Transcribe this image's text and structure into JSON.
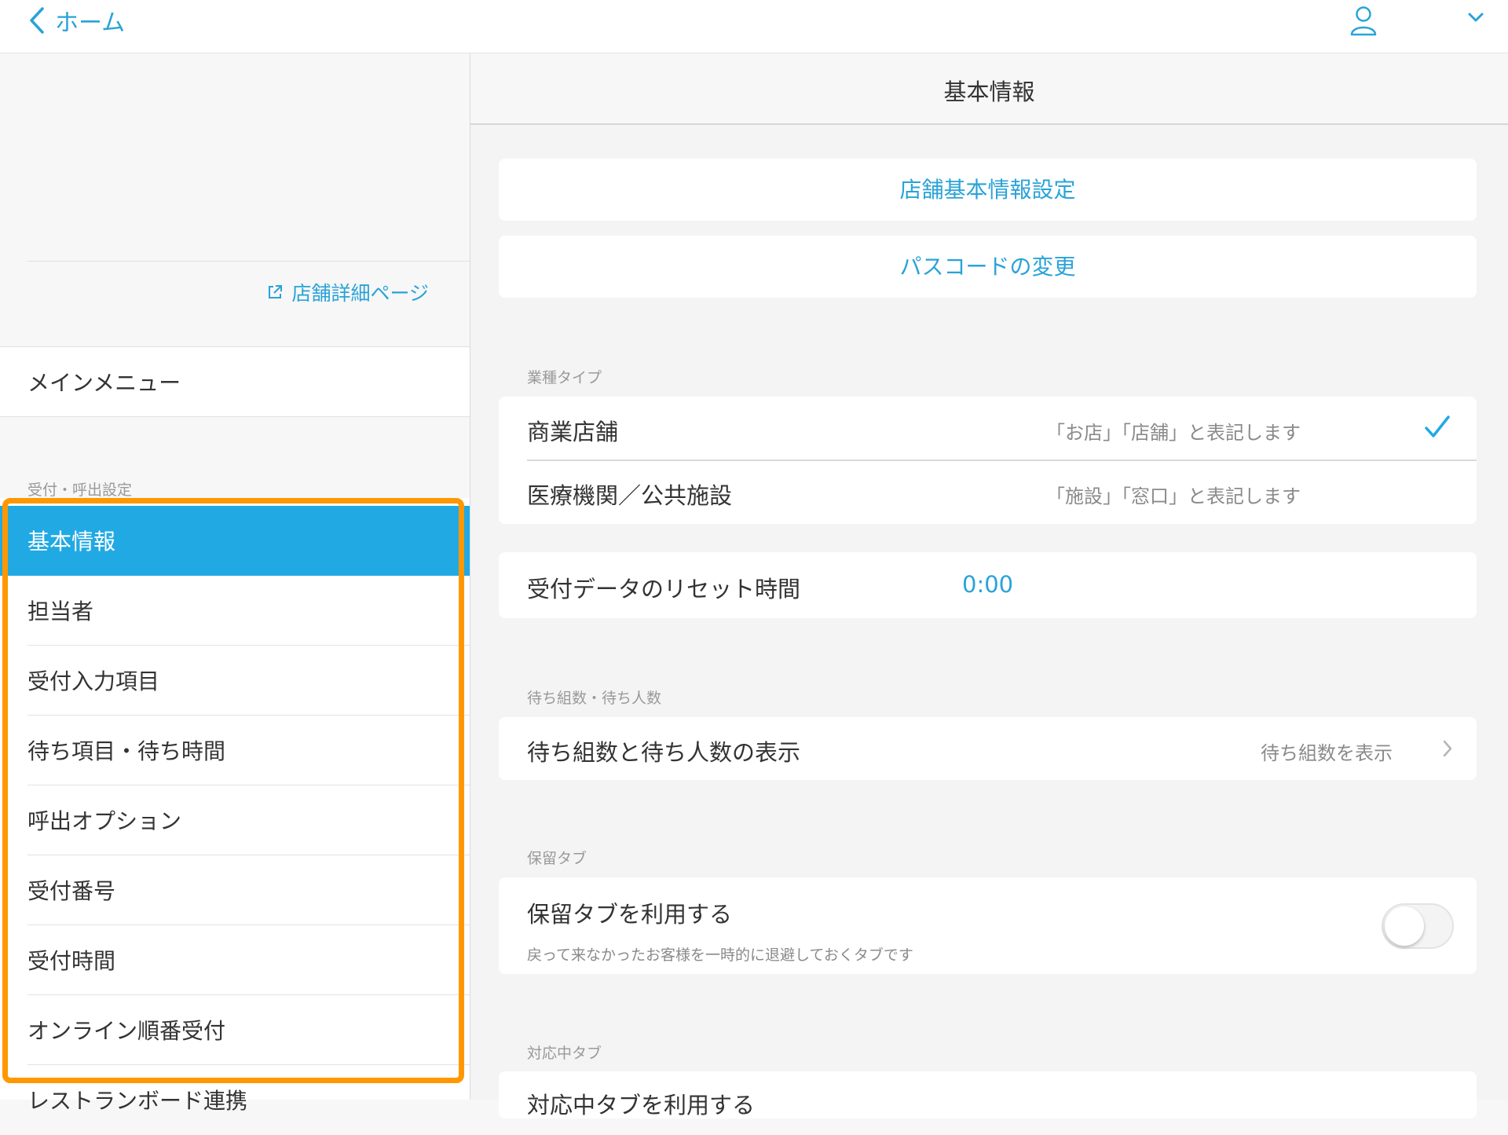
{
  "topbar": {
    "back_label": "ホーム"
  },
  "sidebar": {
    "store_link": "店舗詳細ページ",
    "main_menu": "メインメニュー",
    "section_caption": "受付・呼出設定",
    "items": [
      {
        "label": "基本情報",
        "active": true
      },
      {
        "label": "担当者"
      },
      {
        "label": "受付入力項目"
      },
      {
        "label": "待ち項目・待ち時間"
      },
      {
        "label": "呼出オプション"
      },
      {
        "label": "受付番号"
      },
      {
        "label": "受付時間"
      },
      {
        "label": "オンライン順番受付"
      },
      {
        "label": "レストランボード連携"
      }
    ]
  },
  "main": {
    "title": "基本情報",
    "store_settings_button": "店舗基本情報設定",
    "passcode_button": "パスコードの変更",
    "business_type": {
      "caption": "業種タイプ",
      "options": [
        {
          "label": "商業店舗",
          "desc": "「お店」「店舗」と表記します",
          "selected": true
        },
        {
          "label": "医療機関／公共施設",
          "desc": "「施設」「窓口」と表記します",
          "selected": false
        }
      ]
    },
    "reset": {
      "label": "受付データのリセット時間",
      "value": "0:00"
    },
    "waiting": {
      "caption": "待ち組数・待ち人数",
      "label": "待ち組数と待ち人数の表示",
      "value": "待ち組数を表示"
    },
    "hold_tab": {
      "caption": "保留タブ",
      "label": "保留タブを利用する",
      "description": "戻って来なかったお客様を一時的に退避しておくタブです",
      "enabled": false
    },
    "in_progress_tab": {
      "caption": "対応中タブ",
      "label": "対応中タブを利用する"
    }
  },
  "colors": {
    "accent": "#21a9e3",
    "link": "#2aa3d8",
    "highlight": "#ff9800"
  }
}
